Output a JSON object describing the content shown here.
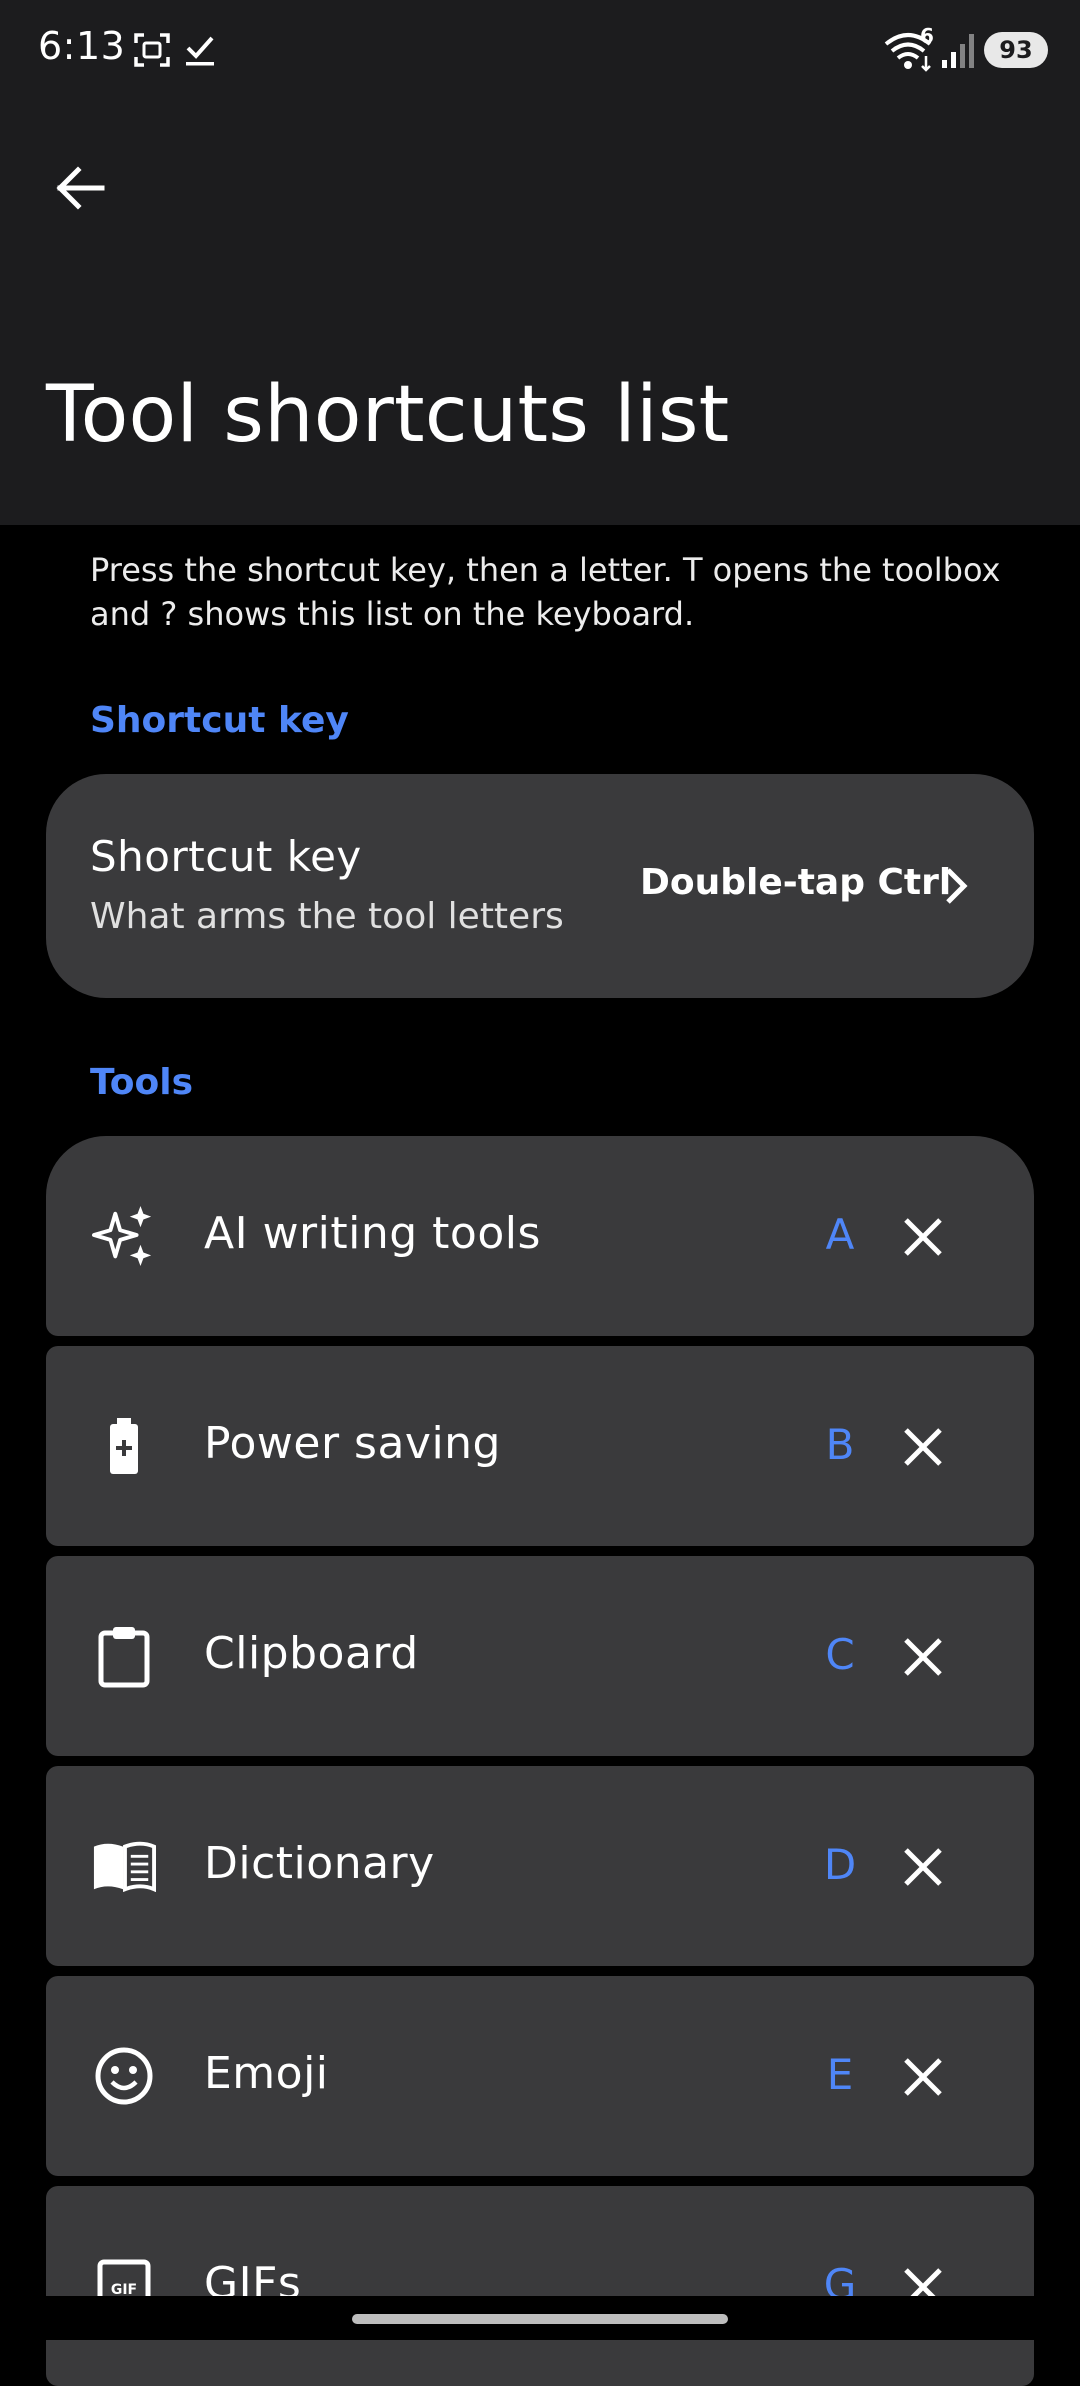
{
  "status_bar": {
    "time": "6:13",
    "wifi_badge": "6",
    "battery": "93",
    "icons": [
      "screenshot-icon",
      "check-icon",
      "wifi-icon",
      "signal-icon",
      "battery-icon"
    ]
  },
  "header": {
    "title": "Tool shortcuts list",
    "back_icon": "arrow-left-icon"
  },
  "description": "Press the shortcut key, then a letter. T opens the toolbox and ? shows this list on the keyboard.",
  "shortcut_section": {
    "header": "Shortcut key",
    "title": "Shortcut key",
    "subtitle": "What arms the tool letters",
    "value": "Double-tap Ctrl"
  },
  "tools_section": {
    "header": "Tools",
    "items": [
      {
        "label": "AI writing tools",
        "letter": "A",
        "icon": "sparkle-icon"
      },
      {
        "label": "Power saving",
        "letter": "B",
        "icon": "battery-plus-icon"
      },
      {
        "label": "Clipboard",
        "letter": "C",
        "icon": "clipboard-icon"
      },
      {
        "label": "Dictionary",
        "letter": "D",
        "icon": "book-icon"
      },
      {
        "label": "Emoji",
        "letter": "E",
        "icon": "smiley-icon"
      },
      {
        "label": "GIFs",
        "letter": "G",
        "icon": "gif-icon"
      }
    ]
  },
  "colors": {
    "accent": "#4f86f7",
    "card": "#3a3a3c",
    "header_bg": "#1c1c1e",
    "background": "#000000"
  }
}
